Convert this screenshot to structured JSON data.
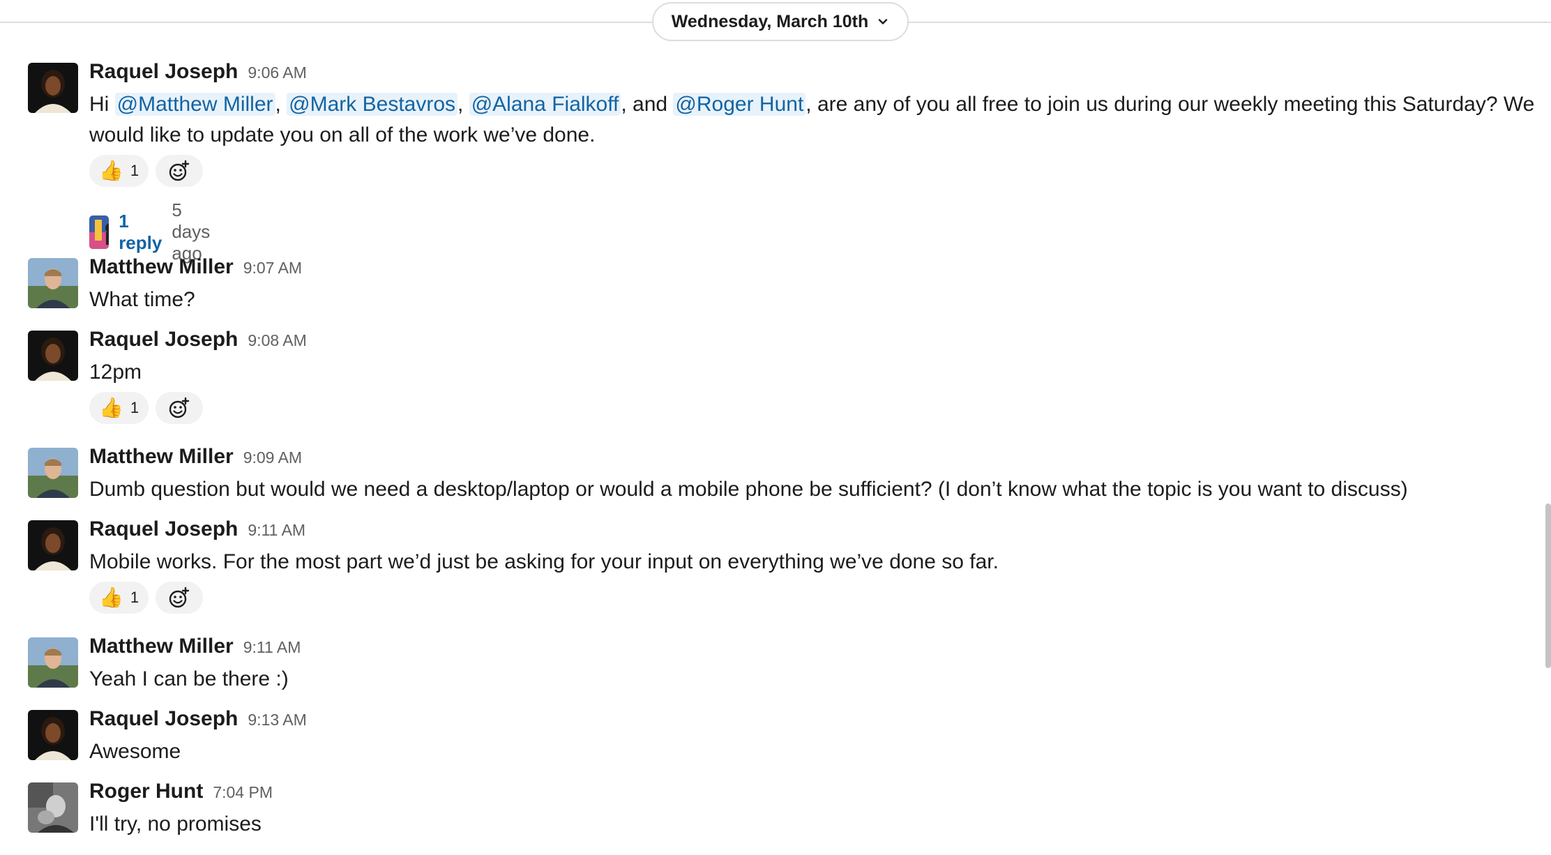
{
  "date_divider": {
    "label": "Wednesday, March 10th"
  },
  "messages": [
    {
      "author": "Raquel Joseph",
      "time": "9:06 AM",
      "text_parts": {
        "p0": "Hi ",
        "m1": "@Matthew Miller",
        "p1": ", ",
        "m2": "@Mark Bestavros",
        "p2": ", ",
        "m3": "@Alana Fialkoff",
        "p3": ", and ",
        "m4": "@Roger Hunt",
        "p4": ", are any of you all free to join us during our weekly meeting this Saturday? We would like to update you on all of the work we’ve done."
      },
      "reaction": {
        "emoji": "👍",
        "count": "1"
      },
      "thread": {
        "reply_label": "1 reply",
        "ago": "5 days ago"
      }
    },
    {
      "author": "Matthew Miller",
      "time": "9:07 AM",
      "text": "What time?"
    },
    {
      "author": "Raquel Joseph",
      "time": "9:08 AM",
      "text": "12pm",
      "reaction": {
        "emoji": "👍",
        "count": "1"
      }
    },
    {
      "author": "Matthew Miller",
      "time": "9:09 AM",
      "text": "Dumb question but would we need a desktop/laptop or would a mobile phone be sufficient? (I don’t know what the topic is you want to discuss)"
    },
    {
      "author": "Raquel Joseph",
      "time": "9:11 AM",
      "text": "Mobile works. For the most part we’d just be asking for your input on everything we’ve done so far.",
      "reaction": {
        "emoji": "👍",
        "count": "1"
      }
    },
    {
      "author": "Matthew Miller",
      "time": "9:11 AM",
      "text": "Yeah I can be there :)"
    },
    {
      "author": "Raquel Joseph",
      "time": "9:13 AM",
      "text": "Awesome"
    },
    {
      "author": "Roger Hunt",
      "time": "7:04 PM",
      "text": "I'll try, no promises"
    }
  ],
  "icons": {
    "chevron": "chevron-down-icon",
    "add_reaction": "add-reaction-icon"
  },
  "colors": {
    "mention": "#1264a3",
    "mention_bg": "#e8f2fa",
    "reaction_bg": "#f2f2f2"
  }
}
